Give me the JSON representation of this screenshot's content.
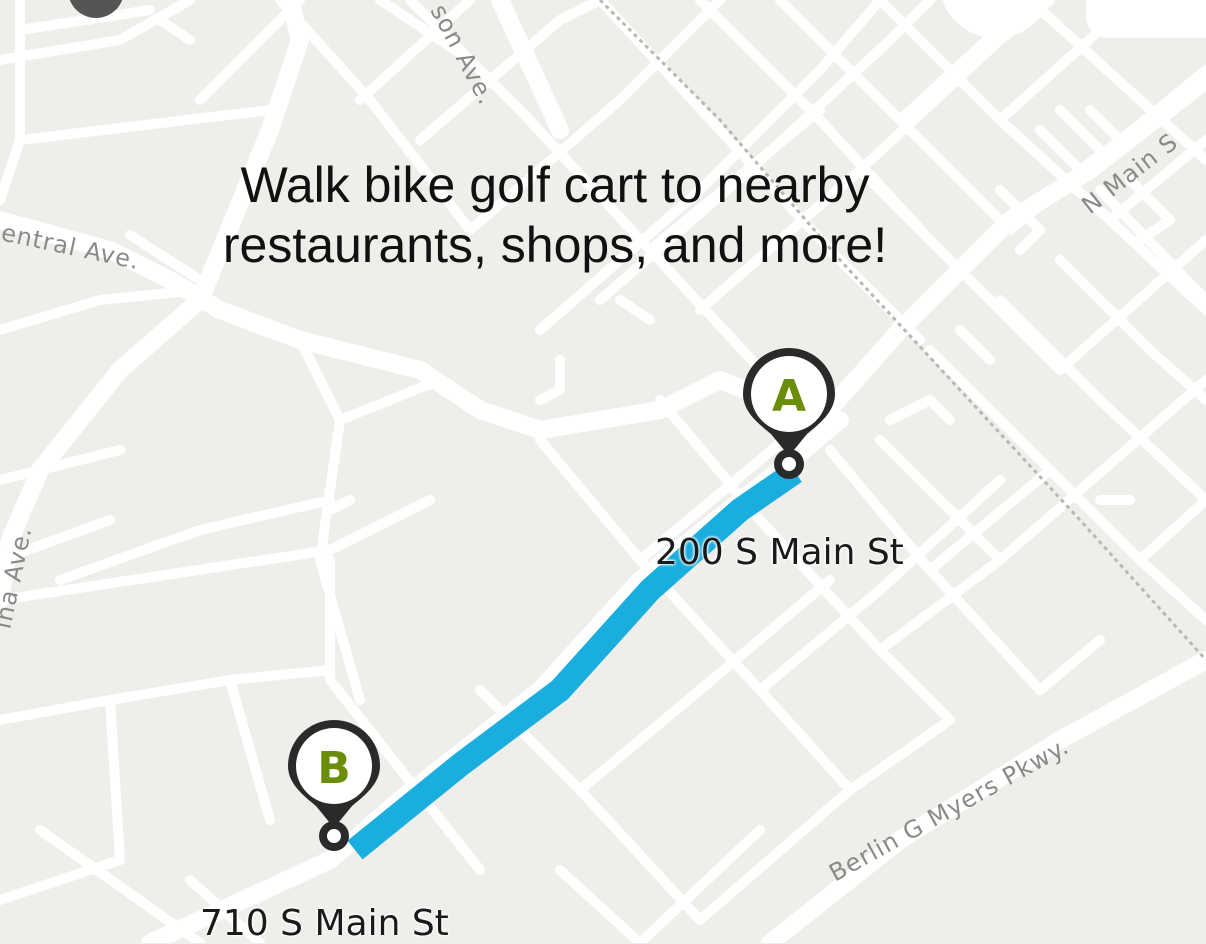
{
  "headline": {
    "line1": "Walk bike golf cart to nearby",
    "line2": "restaurants, shops, and more!"
  },
  "streets": {
    "son_ave": "son Ave.",
    "central_ave": "entral Ave.",
    "n_main": "N Main S",
    "left_ave": "ina Ave.",
    "berlin": "Berlin G Myers Pkwy."
  },
  "markers": {
    "a": {
      "letter": "A",
      "address": "200 S Main St"
    },
    "b": {
      "letter": "B",
      "address": "710 S Main St"
    }
  },
  "colors": {
    "route": "#1aaedf",
    "marker_letter": "#6b8e0a",
    "marker_pin": "#2a2a2a",
    "map_background": "#efeeeb"
  }
}
